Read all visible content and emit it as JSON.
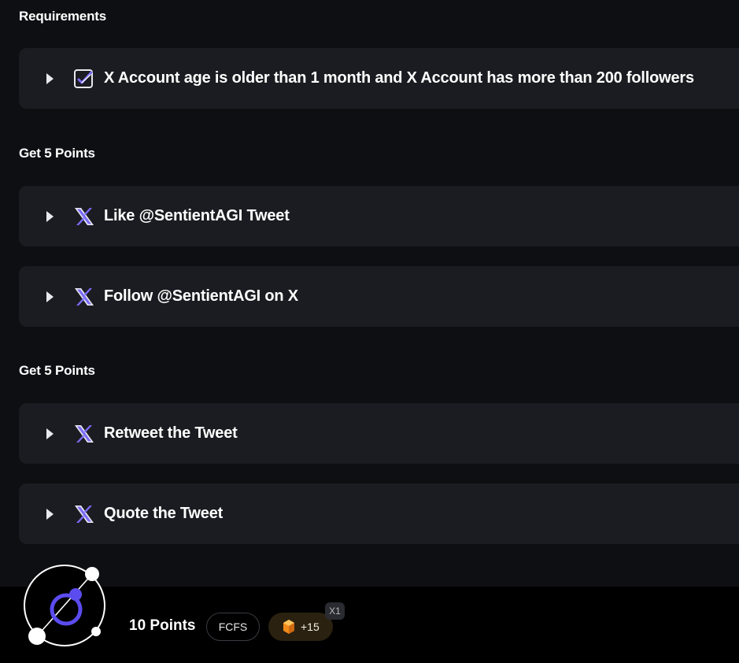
{
  "sections": [
    {
      "title": "Requirements",
      "tasks": [
        {
          "label": "X Account age is older than 1 month and X Account has more than 200 followers",
          "icon": "requirement-check-icon"
        }
      ]
    },
    {
      "title": "Get 5 Points",
      "tasks": [
        {
          "label": "Like @SentientAGI Tweet",
          "icon": "x-logo-icon"
        },
        {
          "label": "Follow @SentientAGI on X",
          "icon": "x-logo-icon"
        }
      ]
    },
    {
      "title": "Get 5 Points",
      "tasks": [
        {
          "label": "Retweet the Tweet",
          "icon": "x-logo-icon"
        },
        {
          "label": "Quote the Tweet",
          "icon": "x-logo-icon"
        }
      ]
    }
  ],
  "footer": {
    "points": "10 Points",
    "type_badge": "FCFS",
    "bonus": "+15",
    "bonus_icon": "gem-icon",
    "multiplier": "X1"
  },
  "colors": {
    "background": "#0e0f13",
    "card": "#1b1c21",
    "accent_purple": "#7b6cf6",
    "bottom_bar": "#000000",
    "bonus_pill": "#2a2110"
  }
}
